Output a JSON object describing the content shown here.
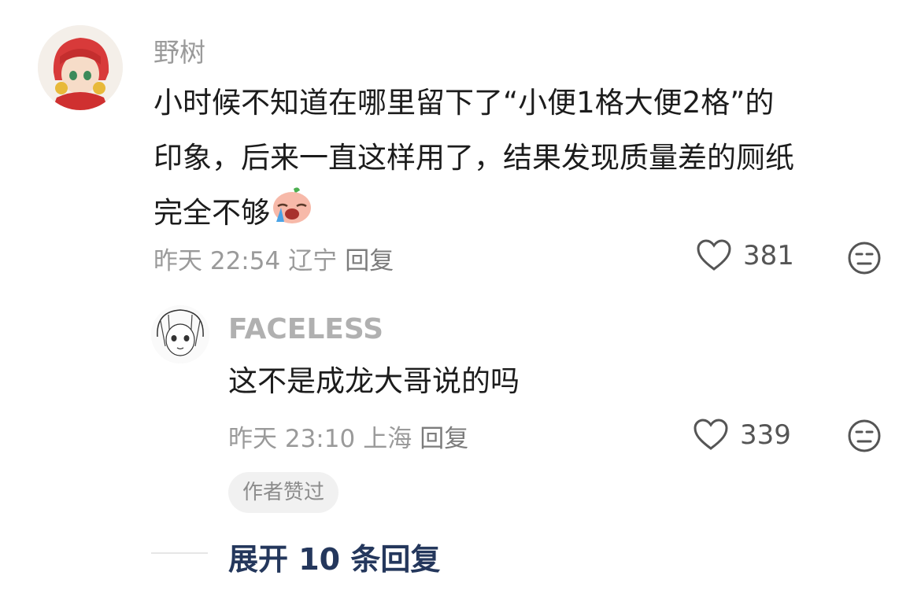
{
  "comment": {
    "username": "野树",
    "text_line1": "小时候不知道在哪里留下了“小便1格大便2格”的",
    "text_line2": "印象，后来一直这样用了，结果发现质量差的厕纸",
    "text_line3": "完全不够",
    "emoji_icon": "crying-face-emoji",
    "time": "昨天 22:54",
    "location": "辽宁",
    "reply_label": "回复",
    "like_count": "381"
  },
  "reply": {
    "username": "FACELESS",
    "text": "这不是成龙大哥说的吗",
    "time": "昨天 23:10",
    "location": "上海",
    "reply_label": "回复",
    "like_count": "339",
    "author_badge": "作者赞过"
  },
  "expand_label": "展开 10 条回复"
}
